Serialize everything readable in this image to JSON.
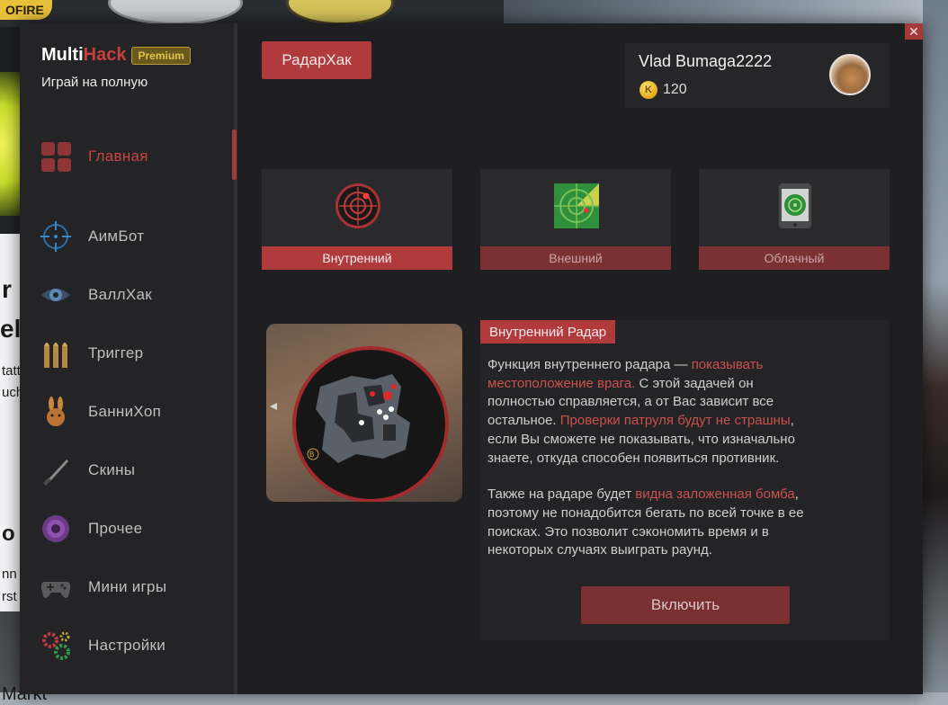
{
  "background": {
    "top_badge_text": "OFIRE",
    "fragments": [
      "r",
      "el",
      "tatt",
      "uch",
      "o",
      "nn",
      "rst"
    ],
    "bottom_text": "Markt"
  },
  "app": {
    "brand": {
      "part1": "Multi",
      "part2": "Hack",
      "badge": "Premium"
    },
    "tagline": "Играй на полную",
    "close_label": "✕",
    "nav": [
      {
        "label": "Главная",
        "icon": "home-grid-icon",
        "active": true
      },
      {
        "label": "АимБот",
        "icon": "crosshair-icon",
        "active": false
      },
      {
        "label": "ВаллХак",
        "icon": "eye-icon",
        "active": false
      },
      {
        "label": "Триггер",
        "icon": "bullets-icon",
        "active": false
      },
      {
        "label": "БанниХоп",
        "icon": "bunny-icon",
        "active": false
      },
      {
        "label": "Скины",
        "icon": "knife-icon",
        "active": false
      },
      {
        "label": "Прочее",
        "icon": "circles-icon",
        "active": false
      },
      {
        "label": "Мини игры",
        "icon": "gamepad-icon",
        "active": false
      },
      {
        "label": "Настройки",
        "icon": "gears-icon",
        "active": false
      }
    ],
    "header": {
      "active_feature": "РадарХак"
    },
    "user": {
      "name": "Vlad Bumaga2222",
      "coin_symbol": "K",
      "coins": "120"
    },
    "modes": [
      {
        "label": "Внутренний",
        "icon": "internal-radar-icon",
        "active": true
      },
      {
        "label": "Внешний",
        "icon": "external-radar-icon",
        "active": false
      },
      {
        "label": "Облачный",
        "icon": "cloud-radar-icon",
        "active": false
      }
    ],
    "info": {
      "title": "Внутренний Радар",
      "p1": [
        {
          "t": "Функция внутреннего радара — ",
          "hl": false
        },
        {
          "t": "показывать местоположение врага.",
          "hl": true
        },
        {
          "t": " С этой задачей он полностью справляется, а от Вас зависит все остальное. ",
          "hl": false
        },
        {
          "t": "Проверки патруля будут не страшны",
          "hl": true
        },
        {
          "t": ", если Вы сможете не показывать, что  изначально знаете, откуда способен появиться противник.",
          "hl": false
        }
      ],
      "p2": [
        {
          "t": "Также на радаре будет ",
          "hl": false
        },
        {
          "t": "видна заложенная бомба",
          "hl": true
        },
        {
          "t": ", поэтому не понадобится бегать по всей точке в ее поисках. Это позволит сэкономить время и в некоторых случаях выиграть раунд.",
          "hl": false
        }
      ],
      "enable_label": "Включить"
    },
    "minimap": {
      "site_label": "B"
    },
    "colors": {
      "accent": "#b13a3c",
      "accent_dim": "#7b3032",
      "highlight": "#c9514f",
      "brand_red": "#c6403f"
    }
  }
}
